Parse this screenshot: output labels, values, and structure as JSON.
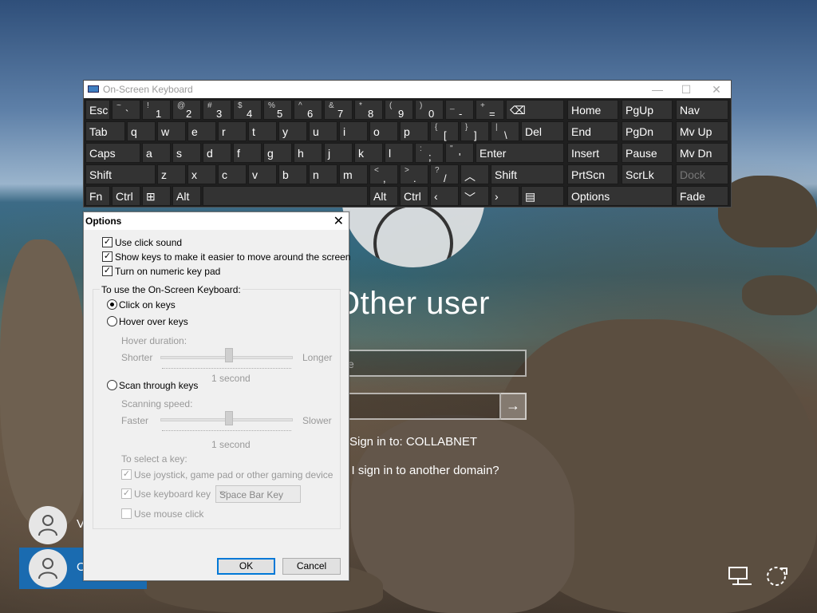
{
  "osk": {
    "title": "On-Screen Keyboard",
    "minimize": "—",
    "maximize": "☐",
    "close": "✕",
    "rows": {
      "r1": [
        {
          "label": "Esc"
        },
        {
          "sup": "~",
          "main": "`"
        },
        {
          "sup": "!",
          "main": "1"
        },
        {
          "sup": "@",
          "main": "2"
        },
        {
          "sup": "#",
          "main": "3"
        },
        {
          "sup": "$",
          "main": "4"
        },
        {
          "sup": "%",
          "main": "5"
        },
        {
          "sup": "^",
          "main": "6"
        },
        {
          "sup": "&",
          "main": "7"
        },
        {
          "sup": "*",
          "main": "8"
        },
        {
          "sup": "(",
          "main": "9"
        },
        {
          "sup": ")",
          "main": "0"
        },
        {
          "sup": "_",
          "main": "-"
        },
        {
          "sup": "+",
          "main": "="
        },
        {
          "label": "⌫"
        }
      ],
      "r2": [
        {
          "label": "Tab"
        },
        {
          "label": "q"
        },
        {
          "label": "w"
        },
        {
          "label": "e"
        },
        {
          "label": "r"
        },
        {
          "label": "t"
        },
        {
          "label": "y"
        },
        {
          "label": "u"
        },
        {
          "label": "i"
        },
        {
          "label": "o"
        },
        {
          "label": "p"
        },
        {
          "sup": "{",
          "main": "["
        },
        {
          "sup": "}",
          "main": "]"
        },
        {
          "sup": "|",
          "main": "\\"
        },
        {
          "label": "Del"
        }
      ],
      "r3": [
        {
          "label": "Caps"
        },
        {
          "label": "a"
        },
        {
          "label": "s"
        },
        {
          "label": "d"
        },
        {
          "label": "f"
        },
        {
          "label": "g"
        },
        {
          "label": "h"
        },
        {
          "label": "j"
        },
        {
          "label": "k"
        },
        {
          "label": "l"
        },
        {
          "sup": ":",
          "main": ";"
        },
        {
          "sup": "\"",
          "main": "'"
        },
        {
          "label": "Enter"
        }
      ],
      "r4": [
        {
          "label": "Shift"
        },
        {
          "label": "z"
        },
        {
          "label": "x"
        },
        {
          "label": "c"
        },
        {
          "label": "v"
        },
        {
          "label": "b"
        },
        {
          "label": "n"
        },
        {
          "label": "m"
        },
        {
          "sup": "<",
          "main": ","
        },
        {
          "sup": ">",
          "main": "."
        },
        {
          "sup": "?",
          "main": "/"
        },
        {
          "label": "︿"
        },
        {
          "label": "Shift"
        }
      ],
      "r5": [
        {
          "label": "Fn"
        },
        {
          "label": "Ctrl"
        },
        {
          "label": "⊞"
        },
        {
          "label": "Alt"
        },
        {
          "label": ""
        },
        {
          "label": "Alt"
        },
        {
          "label": "Ctrl"
        },
        {
          "label": "‹"
        },
        {
          "label": "﹀"
        },
        {
          "label": "›"
        },
        {
          "label": "▤"
        }
      ],
      "nav": [
        [
          "Home",
          "PgUp",
          "Nav"
        ],
        [
          "End",
          "PgDn",
          "Mv Up"
        ],
        [
          "Insert",
          "Pause",
          "Mv Dn"
        ],
        [
          "PrtScn",
          "ScrLk",
          "Dock"
        ],
        [
          "Options",
          "",
          "Fade"
        ]
      ]
    }
  },
  "login": {
    "other_user": "Other user",
    "username_placeholder": "e",
    "submit_arrow": "→",
    "sign_in_to": "Sign in to: COLLABNET",
    "domain_link": "o I sign in to another domain?",
    "users": [
      {
        "name": "V"
      },
      {
        "name": "O"
      }
    ]
  },
  "options": {
    "title": "Options",
    "close": "✕",
    "use_click_sound": "Use click sound",
    "show_keys": "Show keys to make it easier to move around the screen",
    "numeric_pad": "Turn on numeric key pad",
    "group_label": "To use the On-Screen Keyboard:",
    "click_on_keys": "Click on keys",
    "hover_over_keys": "Hover over keys",
    "hover_duration": "Hover duration:",
    "shorter": "Shorter",
    "longer": "Longer",
    "hover_value": "1 second",
    "scan_through_keys": "Scan through keys",
    "scanning_speed": "Scanning speed:",
    "faster": "Faster",
    "slower": "Slower",
    "scan_value": "1 second",
    "to_select_a_key": "To select a key:",
    "use_joystick": "Use joystick, game pad or other gaming device",
    "use_keyboard_key": "Use keyboard key",
    "keyboard_key_value": "Space Bar Key",
    "use_mouse_click": "Use mouse click",
    "ok": "OK",
    "cancel": "Cancel"
  },
  "state": {
    "click_sound": true,
    "show_keys": true,
    "numeric_pad": true,
    "mode": "click",
    "use_joystick": true,
    "use_keyboard_key": true,
    "use_mouse_click": false
  }
}
